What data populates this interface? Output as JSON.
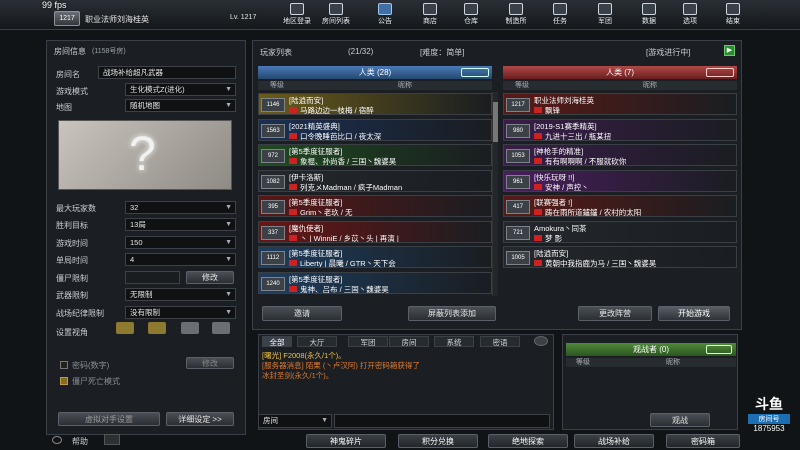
{
  "fps": "99 fps",
  "user": {
    "level_badge": "1217",
    "name": "职业法师刘海桂英",
    "level": "Lv. 1217"
  },
  "nav": [
    {
      "label": "地区登录",
      "icon": "region-icon"
    },
    {
      "label": "房间列表",
      "icon": "room-list-icon"
    },
    {
      "label": "公告",
      "icon": "announcement-icon"
    },
    {
      "label": "商店",
      "icon": "shop-icon"
    },
    {
      "label": "仓库",
      "icon": "warehouse-icon"
    },
    {
      "label": "制造所",
      "icon": "workshop-icon"
    },
    {
      "label": "任务",
      "icon": "task-icon"
    },
    {
      "label": "军团",
      "icon": "clan-icon"
    },
    {
      "label": "数据",
      "icon": "stats-icon"
    },
    {
      "label": "选项",
      "icon": "options-icon"
    },
    {
      "label": "结束",
      "icon": "exit-icon"
    }
  ],
  "room": {
    "header": "房间信息",
    "room_no": "(1158号房)",
    "name_label": "房间名",
    "name_value": "战场补给超凡武器",
    "mode_label": "游戏模式",
    "mode_value": "生化模式Z(进化)",
    "map_label": "地图",
    "map_value": "随机地图",
    "max_players_label": "最大玩家数",
    "max_players_value": "32",
    "win_target_label": "胜利目标",
    "win_target_value": "13局",
    "game_time_label": "游戏时间",
    "game_time_value": "150",
    "round_time_label": "单局时间",
    "round_time_value": "4",
    "zombie_limit_label": "僵尸限制",
    "modify_label": "修改",
    "weapon_limit_label": "武器限制",
    "weapon_limit_value": "无限制",
    "discipline_label": "战场纪律限制",
    "discipline_value": "没有限制",
    "view_label": "设置视角",
    "password_label": "密码(数字)",
    "zombie_remove_label": "僵尸死亡模式",
    "opponent_btn": "虚拟对手设置",
    "detail_btn": "详细设定 >>"
  },
  "player_list": {
    "title": "玩家列表",
    "count": "(21/32)",
    "difficulty": "[难度：简单]",
    "status": "[游戏进行中]",
    "col_level": "等级",
    "col_name": "昵称",
    "humans_left_header": "人类 (28)",
    "humans_right_header": "人类 (7)",
    "left_rows": [
      {
        "lv": "1146",
        "clan": "[陆逍而安]",
        "name": "马路边边一枝梅 / 宿醉",
        "color": "#6b5c1a"
      },
      {
        "lv": "1563",
        "clan": "[2021精英盛典]",
        "name": "口令晚睡芭比口 / 夜太深",
        "color": "#1b2f54"
      },
      {
        "lv": "972",
        "clan": "[第5季度征服者]",
        "name": "象棍、孙尚香 / 三国丶魏婆昊",
        "color": "#1f4a1f"
      },
      {
        "lv": "1082",
        "clan": "[伊卡洛斯]",
        "name": "列克メMadman / 疯子Madman",
        "color": "#24282d"
      },
      {
        "lv": "395",
        "clan": "[第5季度征服者]",
        "name": "Grim丶老玖 / 无",
        "color": "#5a1616"
      },
      {
        "lv": "337",
        "clan": "[魔仇使者]",
        "name": "丶 | WinniE / 乡苡丶头 | 再演 |",
        "color": "#6a1515"
      },
      {
        "lv": "1112",
        "clan": "[第5季度征服者]",
        "name": "Liberty | 晨曦 / GTR丶天下会",
        "color": "#1e3d5e"
      },
      {
        "lv": "1240",
        "clan": "[第5季度征服者]",
        "name": "鬼神、吕布 / 三国丶魏婆昊",
        "color": "#1e3d5e"
      }
    ],
    "right_rows": [
      {
        "lv": "1217",
        "clan": "职业法师刘海桂英",
        "name": "飘锋",
        "color": "#5a1a16"
      },
      {
        "lv": "980",
        "clan": "[2019-S1赛季精英]",
        "name": "九进十三出 / 瓶某扭",
        "color": "#3a1d4a"
      },
      {
        "lv": "1053",
        "clan": "[神枪手的精准]",
        "name": "有有啊啊啊 / 不服就砍你",
        "color": "#3a1d4a"
      },
      {
        "lv": "961",
        "clan": "[快乐玩呀 !!]",
        "name": "安神 / 声控丶",
        "color": "#4a1d5e"
      },
      {
        "lv": "417",
        "clan": "[联赛强者 !]",
        "name": "踌在雨所道鑪鑪 / 农村的太阳",
        "color": "#5a1a16"
      },
      {
        "lv": "721",
        "clan": "Amokura丶同茶",
        "name": "梦 影",
        "color": "#24282d"
      },
      {
        "lv": "1005",
        "clan": "[陆逍而安]",
        "name": "黄朝中我指鹿为马 / 三国丶魏婆昊",
        "color": "#24282d"
      }
    ],
    "invite_btn": "邀请",
    "block_btn": "屏蔽列表添加",
    "change_team_btn": "更改阵营",
    "start_btn": "开始游戏"
  },
  "chat": {
    "tabs": [
      "全部",
      "大厅",
      "军团",
      "房间",
      "系统",
      "密语"
    ],
    "lines": [
      {
        "text": "[曙光] F2008(永久/1个)。",
        "color": "#f0c040"
      },
      {
        "text": "[服务器消息] 陌栗 (丶卢汉阿) 打开密码箱获得了",
        "color": "#e07a2c"
      },
      {
        "text": "冰封圣剑(永久/1个)。",
        "color": "#e07a2c"
      }
    ],
    "channel": "房间",
    "input_placeholder": ""
  },
  "observers": {
    "header": "观战者 (0)",
    "col_level": "等级",
    "col_name": "昵称",
    "btn": "观战"
  },
  "footer": {
    "help": "帮助",
    "buttons": [
      "神鬼碎片",
      "积分兑换",
      "绝地探索",
      "战场补给",
      "密码箱"
    ]
  },
  "watermark": {
    "brand": "斗鱼",
    "room_label": "房间号",
    "room_no": "1875953"
  }
}
